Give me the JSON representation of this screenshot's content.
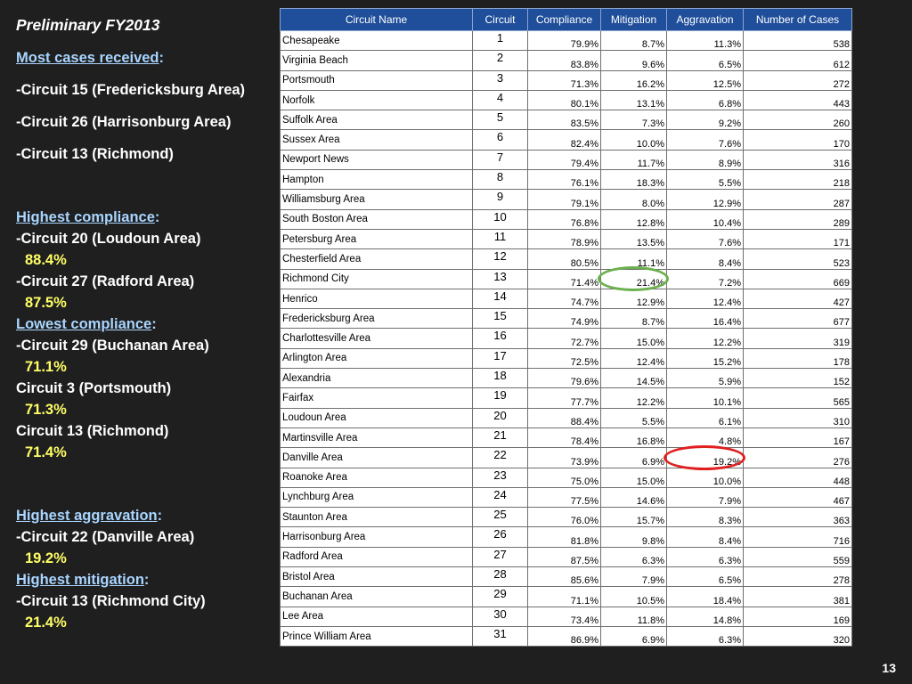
{
  "sidebar": {
    "title": "Preliminary FY2013",
    "most_cases_heading": "Most cases received",
    "most_cases": [
      "-Circuit 15 (Fredericksburg Area)",
      "-Circuit 26 (Harrisonburg Area)",
      "-Circuit 13 (Richmond)"
    ],
    "highest_compliance_heading": "Highest compliance",
    "highest_compliance": [
      {
        "label": "-Circuit 20 (Loudoun Area)",
        "pct": "88.4%"
      },
      {
        "label": "-Circuit 27 (Radford Area)",
        "pct": "87.5%"
      }
    ],
    "lowest_compliance_heading": "Lowest compliance",
    "lowest_compliance": [
      {
        "label": "-Circuit 29 (Buchanan Area)",
        "pct": "71.1%"
      },
      {
        "label": "Circuit 3 (Portsmouth)",
        "pct": "71.3%"
      },
      {
        "label": "Circuit 13 (Richmond)",
        "pct": "71.4%"
      }
    ],
    "highest_aggravation_heading": "Highest aggravation",
    "highest_aggravation": {
      "label": "-Circuit 22 (Danville Area)",
      "pct": "19.2%"
    },
    "highest_mitigation_heading": "Highest mitigation",
    "highest_mitigation": {
      "label": "-Circuit 13 (Richmond City)",
      "pct": "21.4%"
    }
  },
  "table": {
    "headers": [
      "Circuit Name",
      "Circuit",
      "Compliance",
      "Mitigation",
      "Aggravation",
      "Number of Cases"
    ],
    "rows": [
      [
        "Chesapeake",
        "1",
        "79.9%",
        "8.7%",
        "11.3%",
        "538"
      ],
      [
        "Virginia Beach",
        "2",
        "83.8%",
        "9.6%",
        "6.5%",
        "612"
      ],
      [
        "Portsmouth",
        "3",
        "71.3%",
        "16.2%",
        "12.5%",
        "272"
      ],
      [
        "Norfolk",
        "4",
        "80.1%",
        "13.1%",
        "6.8%",
        "443"
      ],
      [
        "Suffolk Area",
        "5",
        "83.5%",
        "7.3%",
        "9.2%",
        "260"
      ],
      [
        "Sussex Area",
        "6",
        "82.4%",
        "10.0%",
        "7.6%",
        "170"
      ],
      [
        "Newport News",
        "7",
        "79.4%",
        "11.7%",
        "8.9%",
        "316"
      ],
      [
        "Hampton",
        "8",
        "76.1%",
        "18.3%",
        "5.5%",
        "218"
      ],
      [
        "Williamsburg Area",
        "9",
        "79.1%",
        "8.0%",
        "12.9%",
        "287"
      ],
      [
        "South Boston Area",
        "10",
        "76.8%",
        "12.8%",
        "10.4%",
        "289"
      ],
      [
        "Petersburg Area",
        "11",
        "78.9%",
        "13.5%",
        "7.6%",
        "171"
      ],
      [
        "Chesterfield Area",
        "12",
        "80.5%",
        "11.1%",
        "8.4%",
        "523"
      ],
      [
        "Richmond City",
        "13",
        "71.4%",
        "21.4%",
        "7.2%",
        "669"
      ],
      [
        "Henrico",
        "14",
        "74.7%",
        "12.9%",
        "12.4%",
        "427"
      ],
      [
        "Fredericksburg Area",
        "15",
        "74.9%",
        "8.7%",
        "16.4%",
        "677"
      ],
      [
        "Charlottesville Area",
        "16",
        "72.7%",
        "15.0%",
        "12.2%",
        "319"
      ],
      [
        "Arlington Area",
        "17",
        "72.5%",
        "12.4%",
        "15.2%",
        "178"
      ],
      [
        "Alexandria",
        "18",
        "79.6%",
        "14.5%",
        "5.9%",
        "152"
      ],
      [
        "Fairfax",
        "19",
        "77.7%",
        "12.2%",
        "10.1%",
        "565"
      ],
      [
        "Loudoun Area",
        "20",
        "88.4%",
        "5.5%",
        "6.1%",
        "310"
      ],
      [
        "Martinsville Area",
        "21",
        "78.4%",
        "16.8%",
        "4.8%",
        "167"
      ],
      [
        "Danville Area",
        "22",
        "73.9%",
        "6.9%",
        "19.2%",
        "276"
      ],
      [
        "Roanoke Area",
        "23",
        "75.0%",
        "15.0%",
        "10.0%",
        "448"
      ],
      [
        "Lynchburg Area",
        "24",
        "77.5%",
        "14.6%",
        "7.9%",
        "467"
      ],
      [
        "Staunton Area",
        "25",
        "76.0%",
        "15.7%",
        "8.3%",
        "363"
      ],
      [
        "Harrisonburg Area",
        "26",
        "81.8%",
        "9.8%",
        "8.4%",
        "716"
      ],
      [
        "Radford Area",
        "27",
        "87.5%",
        "6.3%",
        "6.3%",
        "559"
      ],
      [
        "Bristol Area",
        "28",
        "85.6%",
        "7.9%",
        "6.5%",
        "278"
      ],
      [
        "Buchanan Area",
        "29",
        "71.1%",
        "10.5%",
        "18.4%",
        "381"
      ],
      [
        "Lee Area",
        "30",
        "73.4%",
        "11.8%",
        "14.8%",
        "169"
      ],
      [
        "Prince William Area",
        "31",
        "86.9%",
        "6.9%",
        "6.3%",
        "320"
      ]
    ]
  },
  "highlights": {
    "green_ring_color": "#6ab04c",
    "red_ring_color": "#e02020"
  },
  "page_number": "13"
}
